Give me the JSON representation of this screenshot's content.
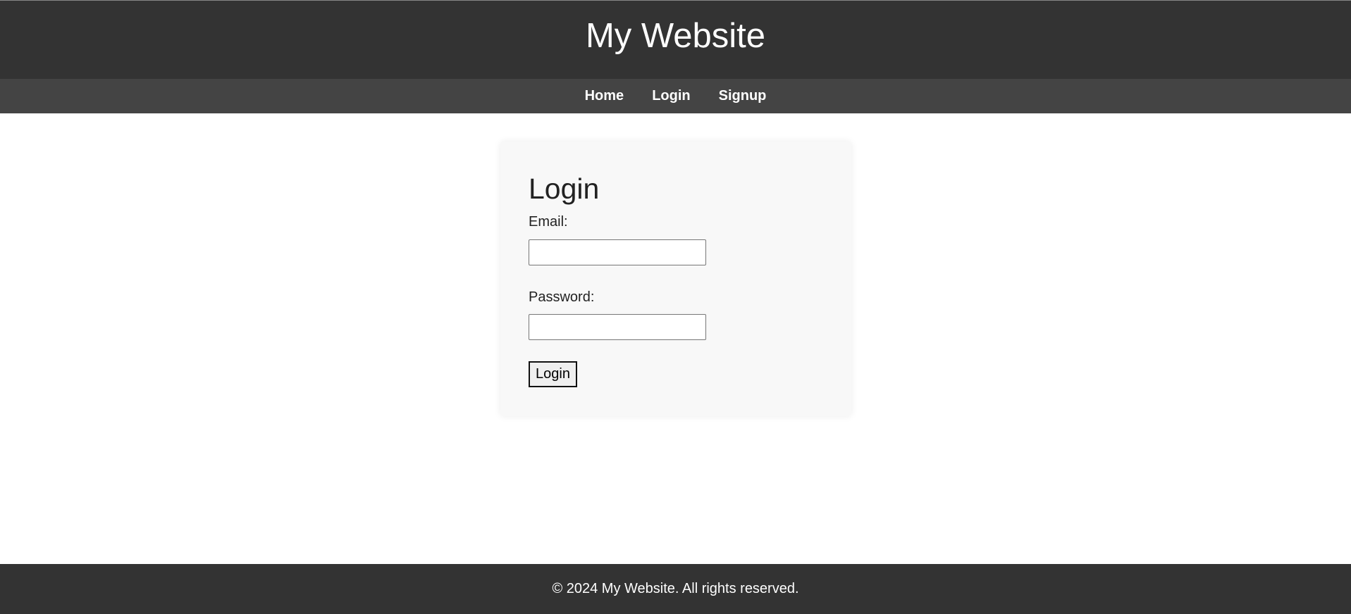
{
  "header": {
    "title": "My Website"
  },
  "nav": {
    "items": [
      {
        "label": "Home"
      },
      {
        "label": "Login"
      },
      {
        "label": "Signup"
      }
    ]
  },
  "login_form": {
    "heading": "Login",
    "email_label": "Email:",
    "email_value": "",
    "password_label": "Password:",
    "password_value": "",
    "submit_label": "Login"
  },
  "footer": {
    "text": "© 2024 My Website. All rights reserved."
  },
  "colors": {
    "header_bg": "#333333",
    "nav_bg": "#444444",
    "card_bg": "#f8f8f8",
    "footer_bg": "#333333"
  }
}
